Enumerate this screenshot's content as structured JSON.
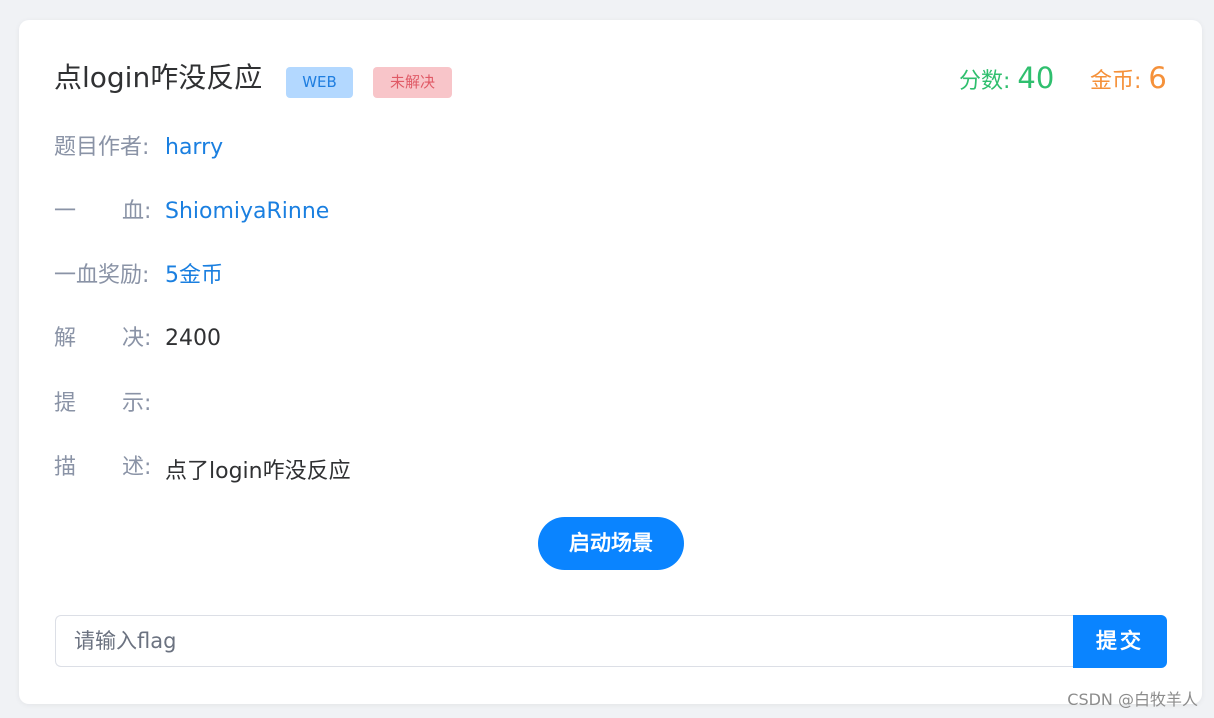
{
  "challenge": {
    "title": "点login咋没反应",
    "category_tag": "WEB",
    "status_tag": "未解决",
    "points_label": "分数: ",
    "points_value": "40",
    "coins_label": "金币: ",
    "coins_value": "6"
  },
  "details": {
    "author_label": "题目作者:",
    "author_value": "harry",
    "first_blood_label_a": "一",
    "first_blood_label_b": "血:",
    "first_blood_value": "ShiomiyaRinne",
    "reward_label": "一血奖励:",
    "reward_value": "5金币",
    "solved_label_a": "解",
    "solved_label_b": "决:",
    "solved_value": "2400",
    "hint_label_a": "提",
    "hint_label_b": "示:",
    "hint_value": "",
    "desc_label_a": "描",
    "desc_label_b": "述:",
    "desc_value": "点了login咋没反应"
  },
  "actions": {
    "launch_label": "启动场景",
    "flag_placeholder": "请输入flag",
    "flag_value": "",
    "submit_label": "提交"
  },
  "watermark": "CSDN @白牧羊人",
  "colors": {
    "primary": "#0a84ff",
    "points": "#2fbf6e",
    "coins": "#f5913a",
    "link": "#1a7fe0",
    "label": "#8a93a6"
  }
}
